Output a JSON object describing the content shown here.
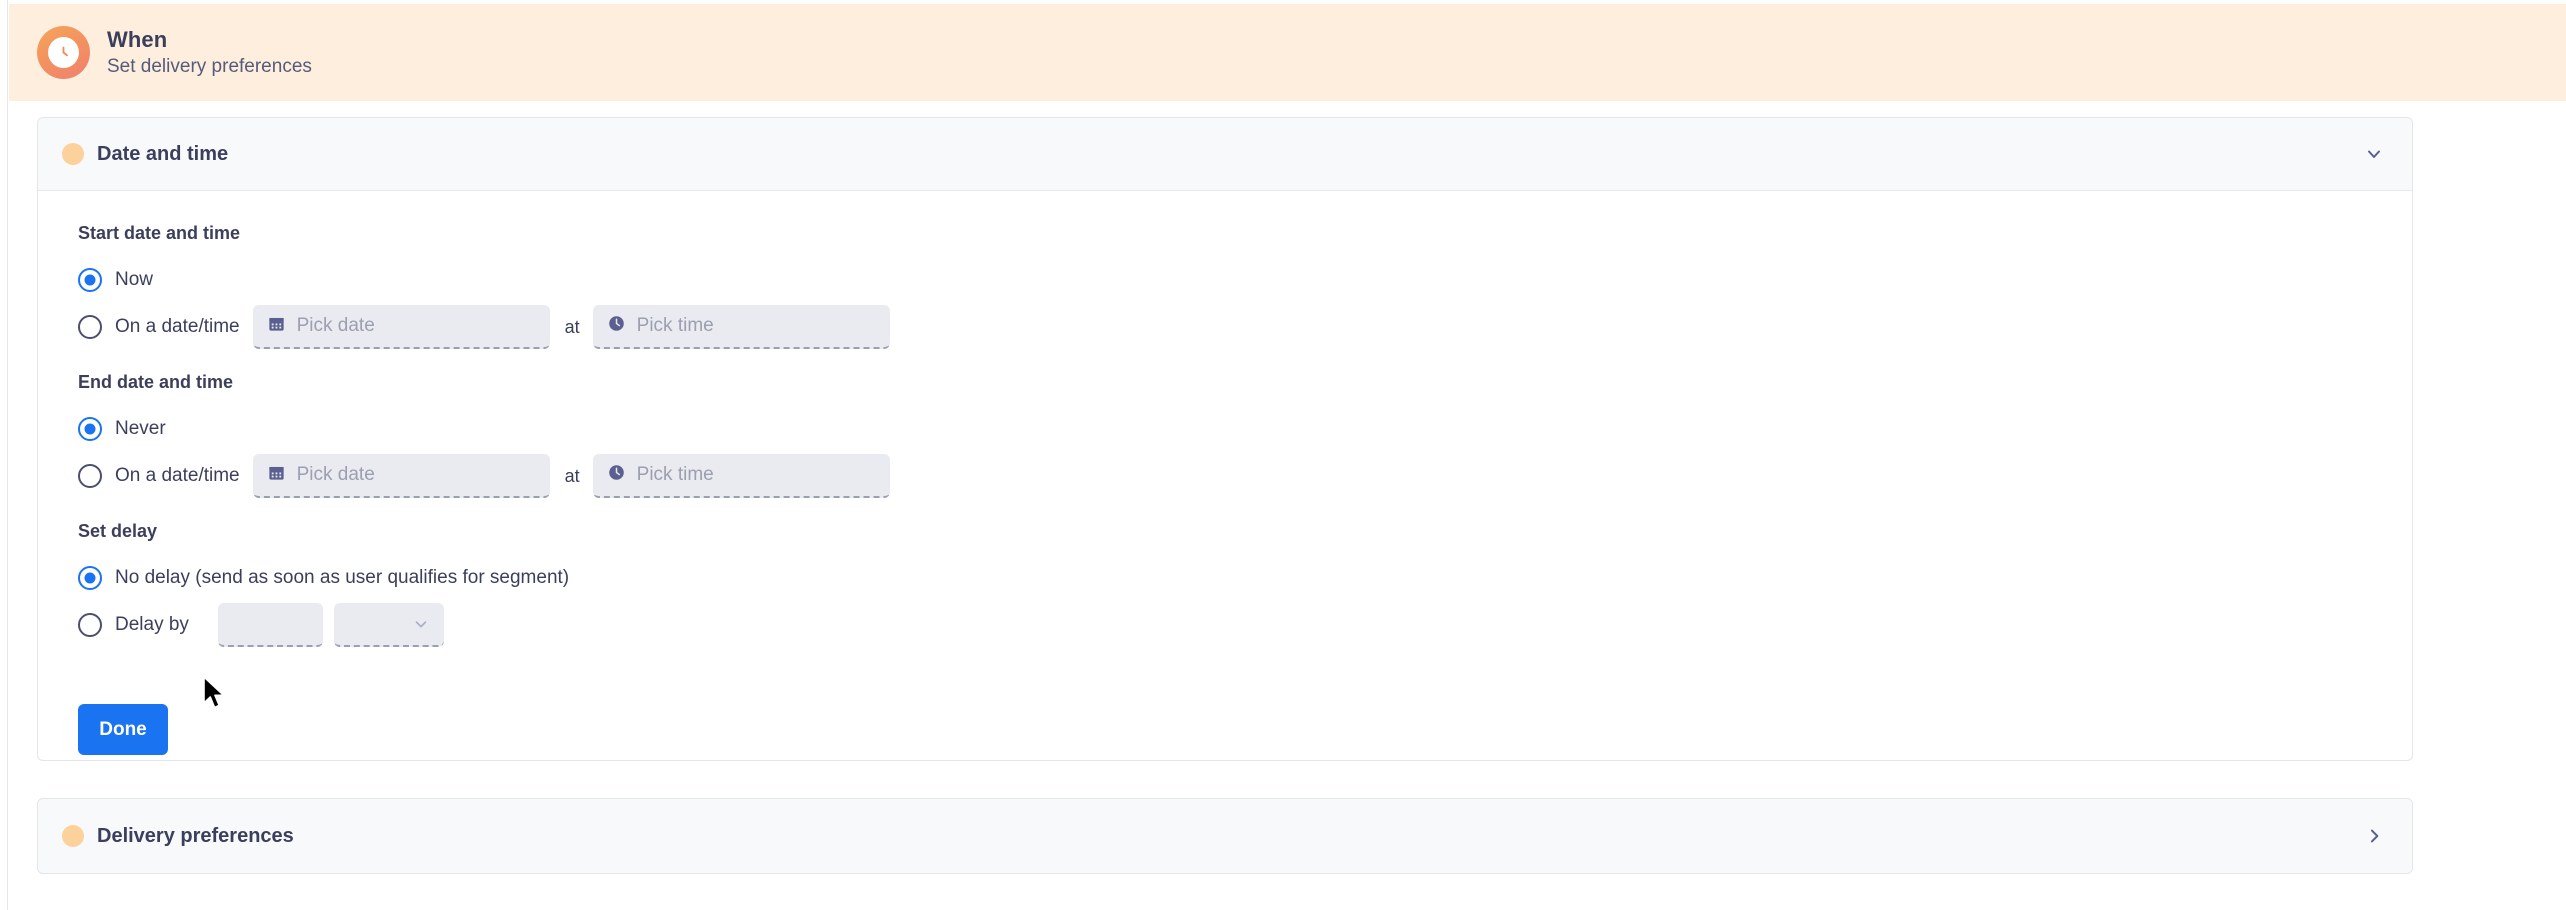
{
  "header": {
    "icon": "clock-icon",
    "title": "When",
    "subtitle": "Set delivery preferences",
    "bg_color": "#fdeedd",
    "icon_gradient_from": "#f6a55c",
    "icon_gradient_to": "#ef8070"
  },
  "sections": {
    "date_and_time": {
      "title": "Date and time",
      "bullet_color": "#fcd19b",
      "expanded": true,
      "chevron": "chevron-down-icon",
      "start": {
        "label": "Start date and time",
        "options": [
          {
            "label": "Now",
            "selected": true
          },
          {
            "label": "On a date/time",
            "selected": false
          }
        ],
        "date_placeholder": "Pick date",
        "date_value": "",
        "separator": "at",
        "time_placeholder": "Pick time",
        "time_value": ""
      },
      "end": {
        "label": "End date and time",
        "options": [
          {
            "label": "Never",
            "selected": true
          },
          {
            "label": "On a date/time",
            "selected": false
          }
        ],
        "date_placeholder": "Pick date",
        "date_value": "",
        "separator": "at",
        "time_placeholder": "Pick time",
        "time_value": ""
      },
      "delay": {
        "label": "Set delay",
        "options": [
          {
            "label": "No delay (send as soon as user qualifies for segment)",
            "selected": true
          },
          {
            "label": "Delay by",
            "selected": false
          }
        ],
        "amount_value": "",
        "amount_placeholder": "",
        "unit_value": "",
        "unit_placeholder": "",
        "unit_chevron": "chevron-down-icon"
      },
      "done_label": "Done",
      "done_color": "#1a73f0"
    },
    "delivery_preferences": {
      "title": "Delivery preferences",
      "bullet_color": "#fcd19b",
      "expanded": false,
      "chevron": "chevron-right-icon"
    }
  }
}
